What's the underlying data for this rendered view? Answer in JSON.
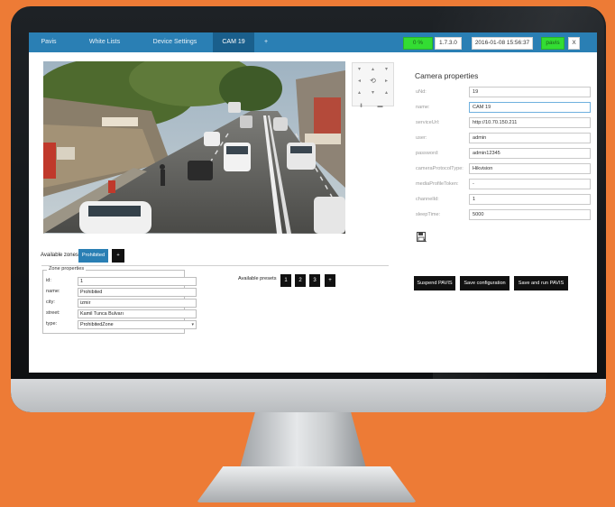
{
  "tabs": [
    {
      "label": "Pavis"
    },
    {
      "label": "White Lists"
    },
    {
      "label": "Device Settings"
    },
    {
      "label": "CAM 19"
    },
    {
      "label": "+"
    }
  ],
  "status": {
    "percent": "0 %",
    "version": "1.7.3.0",
    "datetime": "2016-01-08 15:56:37",
    "user": "pavis",
    "close": "X"
  },
  "ptz": {
    "buttons": [
      "▾",
      "▴",
      "▾",
      "◂",
      "⟲",
      "▸",
      "▴",
      "▾",
      "▴",
      "⬇",
      "▬"
    ]
  },
  "camera_properties": {
    "title": "Camera properties",
    "fields": [
      {
        "label": "uNd:",
        "value": "19"
      },
      {
        "label": "name:",
        "value": "CAM 19"
      },
      {
        "label": "serviceUrl:",
        "value": "http://10.70.150.211"
      },
      {
        "label": "user:",
        "value": "admin"
      },
      {
        "label": "password:",
        "value": "admin12345"
      },
      {
        "label": "cameraProtocolType:",
        "value": "Hikvision"
      },
      {
        "label": "mediaProfileToken:",
        "value": "-"
      },
      {
        "label": "channelId:",
        "value": "1"
      },
      {
        "label": "sleepTime:",
        "value": "5000"
      }
    ]
  },
  "zones": {
    "available_label": "Available zones",
    "items": [
      "Prohibited"
    ],
    "add_label": "+"
  },
  "zone_properties": {
    "legend": "Zone properties",
    "fields": [
      {
        "label": "id:",
        "value": "1"
      },
      {
        "label": "name:",
        "value": "Prohibited"
      },
      {
        "label": "city:",
        "value": "izmir"
      },
      {
        "label": "street:",
        "value": "Kamil Tunca Bulvarı"
      },
      {
        "label": "type:",
        "value": "ProhibitedZone"
      }
    ]
  },
  "presets": {
    "label": "Available presets",
    "items": [
      "1",
      "2",
      "3"
    ],
    "add_label": "+"
  },
  "actions": {
    "suspend": "Suspend PAVIS",
    "save_config": "Save configuration",
    "save_run": "Save and run PAVIS"
  },
  "colors": {
    "background": "#ed7b36",
    "tab_bar": "#2a7fb4",
    "tab_active": "#1a5f8c",
    "status_green": "#33dd33",
    "chip_blue": "#2a7fb4"
  }
}
